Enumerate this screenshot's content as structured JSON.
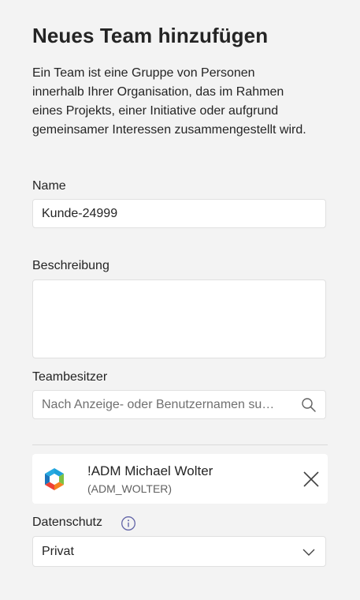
{
  "header": {
    "title": "Neues Team hinzufügen",
    "description_lines": [
      "Ein Team ist eine Gruppe von Personen",
      "innerhalb Ihrer Organisation, das im Rahmen",
      "eines Projekts, einer Initiative oder aufgrund",
      "gemeinsamer Interessen zusammengestellt wird."
    ]
  },
  "form": {
    "name": {
      "label": "Name",
      "value": "Kunde-24999"
    },
    "description": {
      "label": "Beschreibung",
      "value": ""
    },
    "owners": {
      "label": "Teambesitzer",
      "search_placeholder": "Nach Anzeige- oder Benutzernamen su…",
      "list": [
        {
          "display_name": "!ADM Michael Wolter",
          "user_name": "(ADM_WOLTER)"
        }
      ]
    },
    "privacy": {
      "label": "Datenschutz",
      "selected": "Privat"
    }
  },
  "colors": {
    "background": "#f3f3f3",
    "field_background": "#ffffff",
    "text": "#242424",
    "accent": "#6264a7"
  },
  "icons": [
    "search-icon",
    "close-icon",
    "info-icon",
    "chevron-down-icon",
    "app-logo-icon"
  ]
}
